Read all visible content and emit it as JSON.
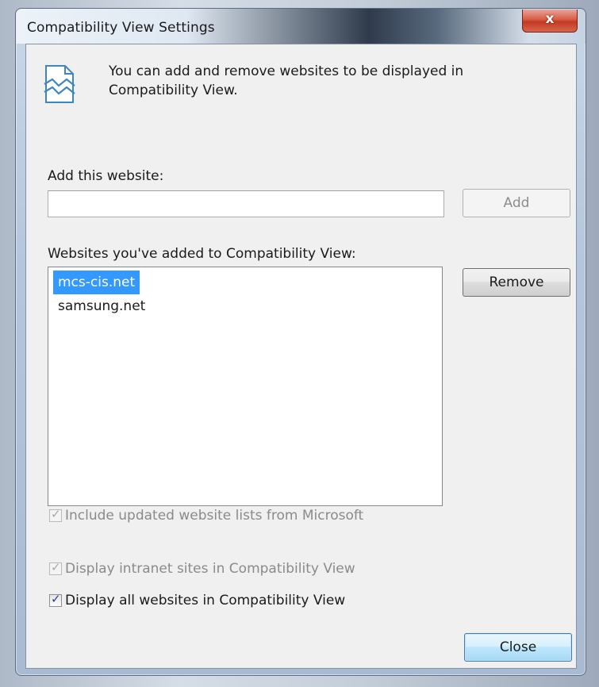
{
  "window": {
    "title": "Compatibility View Settings",
    "close_glyph": "x"
  },
  "info": {
    "icon": "compatibility-view-icon",
    "text": "You can add and remove websites to be displayed in Compatibility View."
  },
  "add_section": {
    "label": "Add this website:",
    "input_value": "",
    "add_button": "Add"
  },
  "list_section": {
    "label": "Websites you've added to Compatibility View:",
    "sites": [
      "mcs-cis.net",
      "samsung.net"
    ],
    "selected_index": 0,
    "remove_button": "Remove"
  },
  "options": [
    {
      "label": "Include updated website lists from Microsoft",
      "checked": true,
      "enabled": false
    },
    {
      "label": "Display intranet sites in Compatibility View",
      "checked": true,
      "enabled": false
    },
    {
      "label": "Display all websites in Compatibility View",
      "checked": true,
      "enabled": true
    }
  ],
  "footer": {
    "close_button": "Close"
  }
}
